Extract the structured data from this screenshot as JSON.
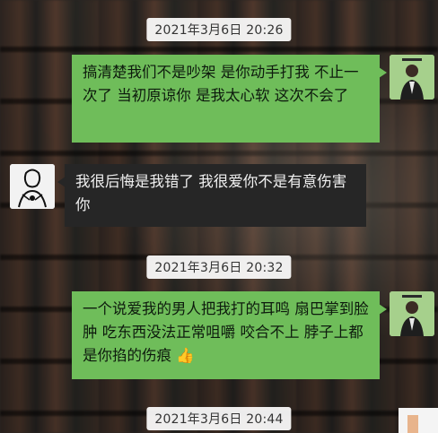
{
  "conversation": {
    "messages": [
      {
        "timestamp": "2021年3月6日 20:26"
      },
      {
        "sender": "me",
        "text": "搞清楚我们不是吵架 是你动手打我 不止一次了 当初原谅你 是我太心软 这次不会了"
      },
      {
        "sender": "other",
        "text": "我很后悔是我错了 我很爱你不是有意伤害你"
      },
      {
        "timestamp": "2021年3月6日 20:32"
      },
      {
        "sender": "me",
        "text": "一个说爱我的男人把我打的耳鸣 扇巴掌到脸肿 吃东西没法正常咀嚼 咬合不上 脖子上都是你掐的伤痕",
        "emoji": "👍"
      },
      {
        "timestamp": "2021年3月6日 20:44"
      }
    ]
  },
  "colors": {
    "sent_bubble": "#6fbd5a",
    "received_bubble": "#262626",
    "timestamp_bg": "#ffffff"
  },
  "icons": {
    "sent_avatar": "person-avatar-icon",
    "received_avatar": "sketch-avatar-icon",
    "reaction": "thumbs-up-icon"
  }
}
